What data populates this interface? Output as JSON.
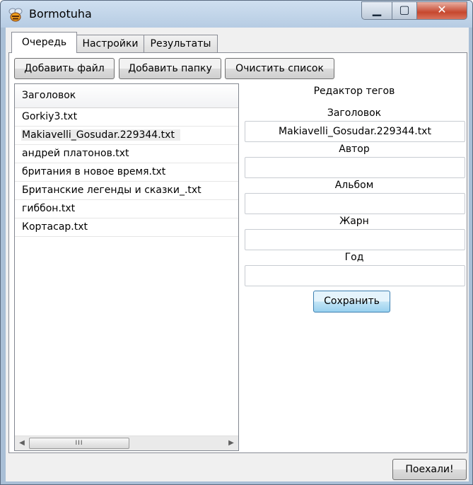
{
  "window": {
    "title": "Bormotuha",
    "minimize": "▁",
    "maximize": "▢",
    "close": "✕"
  },
  "tabs": [
    {
      "label": "Очередь",
      "active": true
    },
    {
      "label": "Настройки",
      "active": false
    },
    {
      "label": "Результаты",
      "active": false
    }
  ],
  "toolbar": {
    "add_file": "Добавить файл",
    "add_folder": "Добавить папку",
    "clear_list": "Очистить список"
  },
  "file_list": {
    "header": "Заголовок",
    "items": [
      "Gorkiy3.txt",
      "Makiavelli_Gosudar.229344.txt",
      "андрей платонов.txt",
      "британия в новое время.txt",
      "Британские легенды и сказки_.txt",
      "гиббон.txt",
      "Кортасар.txt"
    ],
    "selected_index": 1,
    "scroll_left": "◀",
    "scroll_right": "▶",
    "scroll_grip": "III"
  },
  "tag_editor": {
    "heading": "Редактор тегов",
    "title_label": "Заголовок",
    "title_value": "Makiavelli_Gosudar.229344.txt",
    "author_label": "Автор",
    "author_value": "",
    "album_label": "Альбом",
    "album_value": "",
    "genre_label": "Жарн",
    "genre_value": "",
    "year_label": "Год",
    "year_value": "",
    "save": "Сохранить"
  },
  "footer": {
    "go": "Поехали!"
  }
}
